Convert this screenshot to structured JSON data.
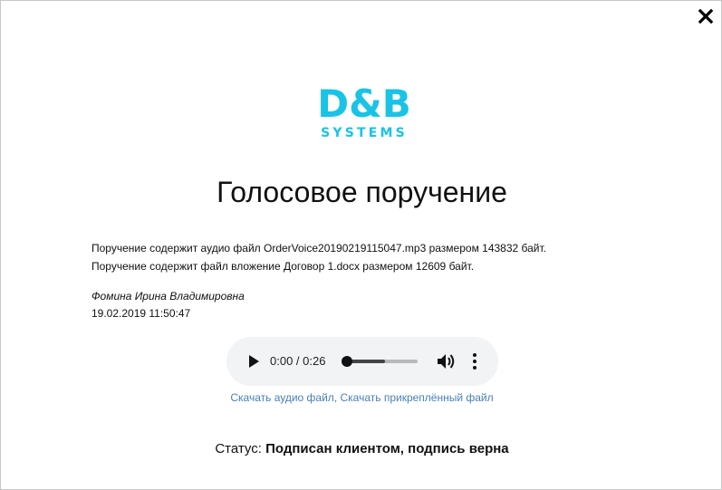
{
  "dialog": {
    "close_icon": "close-icon",
    "logo": {
      "brand": "D&B",
      "tagline": "SYSTEMS",
      "color": "#19c3e6"
    },
    "title": "Голосовое поручение",
    "info_lines": [
      "Поручение содержит аудио файл OrderVoice20190219115047.mp3 размером 143832 байт.",
      "Поручение содержит файл вложение Договор 1.docx размером 12609 байт."
    ],
    "signer_name": "Фомина Ирина Владимировна",
    "signed_at": "19.02.2019 11:50:47",
    "player": {
      "time": "0:00 / 0:26",
      "progress": 0.0,
      "buffered": 0.54,
      "play_icon": "play-icon",
      "volume_icon": "volume-icon",
      "menu_icon": "more-vert-icon"
    },
    "links": {
      "download_audio": "Скачать аудио файл",
      "separator": ", ",
      "download_attachment": "Скачать прикреплённый файл",
      "color": "#4a7fb5"
    },
    "status": {
      "label": "Статус: ",
      "value": "Подписан клиентом, подпись верна"
    }
  }
}
